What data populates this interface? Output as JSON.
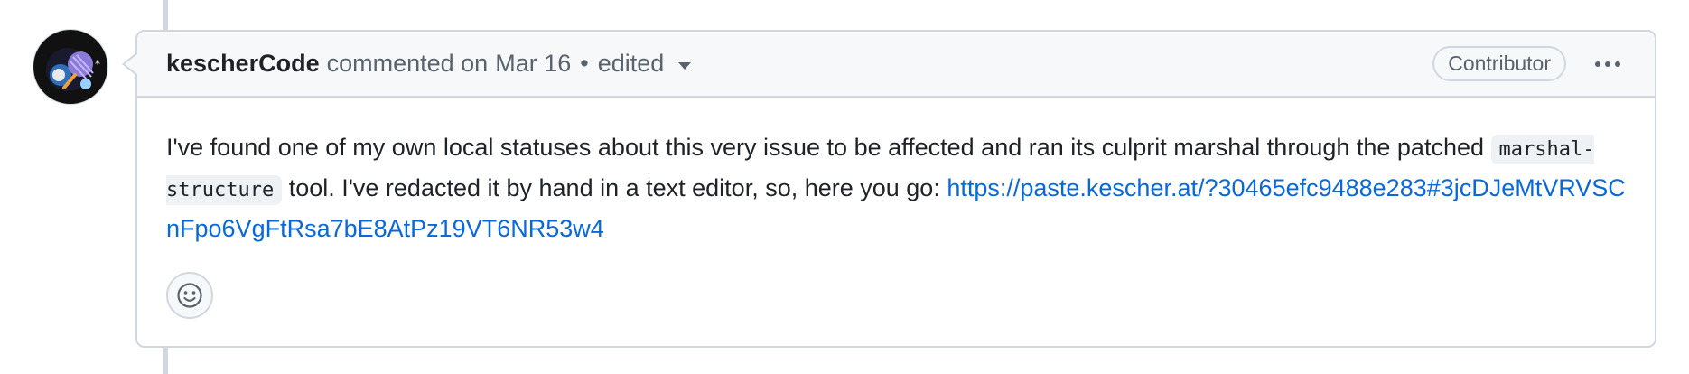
{
  "comment": {
    "author": "kescherCode",
    "action": "commented on",
    "date": "Mar 16",
    "separator": "•",
    "edited_label": "edited",
    "badge": "Contributor",
    "body": {
      "text1": "I've found one of my own local statuses about this very issue to be affected and ran its culprit marshal through the patched ",
      "code": "marshal-structure",
      "text2": " tool. I've redacted it by hand in a text editor, so, here you go: ",
      "link": "https://paste.kescher.at/?30465efc9488e283#3jcDJeMtVRVSCnFpo6VgFtRsa7bE8AtPz19VT6NR53w4"
    }
  },
  "icons": {
    "avatar": "user-avatar",
    "edited_dropdown": "chevron-down-icon",
    "menu": "kebab-horizontal-icon",
    "reaction": "smiley-icon"
  },
  "colors": {
    "link": "#0969da",
    "border": "#d0d7de",
    "header_bg": "#f6f8fa",
    "muted_text": "#59636e"
  }
}
